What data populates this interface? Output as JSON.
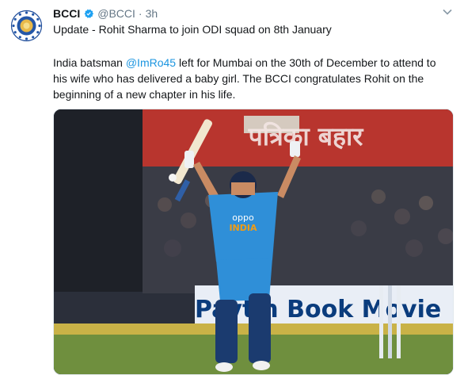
{
  "tweet": {
    "avatar_icon": "bcci-logo-icon",
    "account_name": "BCCI",
    "verified_icon": "verified-badge-icon",
    "handle": "@BCCI",
    "separator": "·",
    "time": "3h",
    "menu_icon": "chevron-down-icon",
    "title": "Update - Rohit Sharma to join ODI squad on 8th January",
    "body_before": "India batsman ",
    "mention": "@ImRo45",
    "body_after": " left for Mumbai on the 30th of December to attend to his wife who has delivered a baby girl. The BCCI congratulates Rohit on the beginning of a new chapter in his life.",
    "photo": {
      "banner_text": "पत्रिका बहार",
      "ad_text": "Paytm Book Movie",
      "jersey_brand": "oppo",
      "jersey_text": "INDIA"
    }
  },
  "colors": {
    "link": "#1b95e0",
    "verified": "#1da1f2",
    "secondary_text": "#657786",
    "jersey_blue": "#2f8fd8",
    "banner_red": "#c0392b"
  }
}
